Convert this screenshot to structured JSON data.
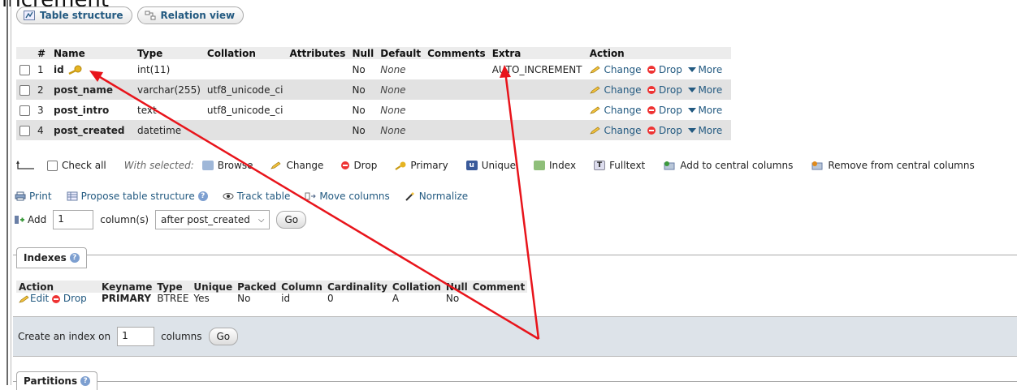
{
  "page_title_fragment": "increment",
  "tabs": [
    {
      "label": "Table structure",
      "icon": "table-structure-icon"
    },
    {
      "label": "Relation view",
      "icon": "relation-view-icon"
    }
  ],
  "structure": {
    "headers": [
      "",
      "#",
      "Name",
      "Type",
      "Collation",
      "Attributes",
      "Null",
      "Default",
      "Comments",
      "Extra",
      "Action"
    ],
    "rows": [
      {
        "num": "1",
        "name": "id",
        "type": "int(11)",
        "collation": "",
        "attributes": "",
        "null": "No",
        "default": "None",
        "comments": "",
        "extra": "AUTO_INCREMENT",
        "primary": true
      },
      {
        "num": "2",
        "name": "post_name",
        "type": "varchar(255)",
        "collation": "utf8_unicode_ci",
        "attributes": "",
        "null": "No",
        "default": "None",
        "comments": "",
        "extra": ""
      },
      {
        "num": "3",
        "name": "post_intro",
        "type": "text",
        "collation": "utf8_unicode_ci",
        "attributes": "",
        "null": "No",
        "default": "None",
        "comments": "",
        "extra": ""
      },
      {
        "num": "4",
        "name": "post_created",
        "type": "datetime",
        "collation": "",
        "attributes": "",
        "null": "No",
        "default": "None",
        "comments": "",
        "extra": ""
      }
    ],
    "actions": {
      "change": "Change",
      "drop": "Drop",
      "more": "More"
    }
  },
  "bulk": {
    "check_all": "Check all",
    "with_selected": "With selected:",
    "browse": "Browse",
    "change": "Change",
    "drop": "Drop",
    "primary": "Primary",
    "unique": "Unique",
    "index": "Index",
    "fulltext": "Fulltext",
    "add_central": "Add to central columns",
    "remove_central": "Remove from central columns"
  },
  "links": {
    "print": "Print",
    "propose": "Propose table structure",
    "track": "Track table",
    "move": "Move columns",
    "normalize": "Normalize"
  },
  "add_column": {
    "label": "Add",
    "count": "1",
    "unit": "column(s)",
    "position": "after post_created",
    "go": "Go"
  },
  "indexes": {
    "legend": "Indexes",
    "headers": [
      "Action",
      "Keyname",
      "Type",
      "Unique",
      "Packed",
      "Column",
      "Cardinality",
      "Collation",
      "Null",
      "Comment"
    ],
    "row": {
      "edit": "Edit",
      "drop": "Drop",
      "keyname": "PRIMARY",
      "type": "BTREE",
      "unique": "Yes",
      "packed": "No",
      "column": "id",
      "cardinality": "0",
      "collation": "A",
      "null": "No",
      "comment": ""
    },
    "create_label": "Create an index on",
    "create_count": "1",
    "create_unit": "columns",
    "go": "Go"
  },
  "partitions": {
    "legend": "Partitions"
  },
  "colors": {
    "link": "#235a81",
    "header_bg": "#ececec",
    "row_alt": "#e2e2e2",
    "annotation_arrow": "#e8141b",
    "panel_bg": "#dde3e9"
  }
}
